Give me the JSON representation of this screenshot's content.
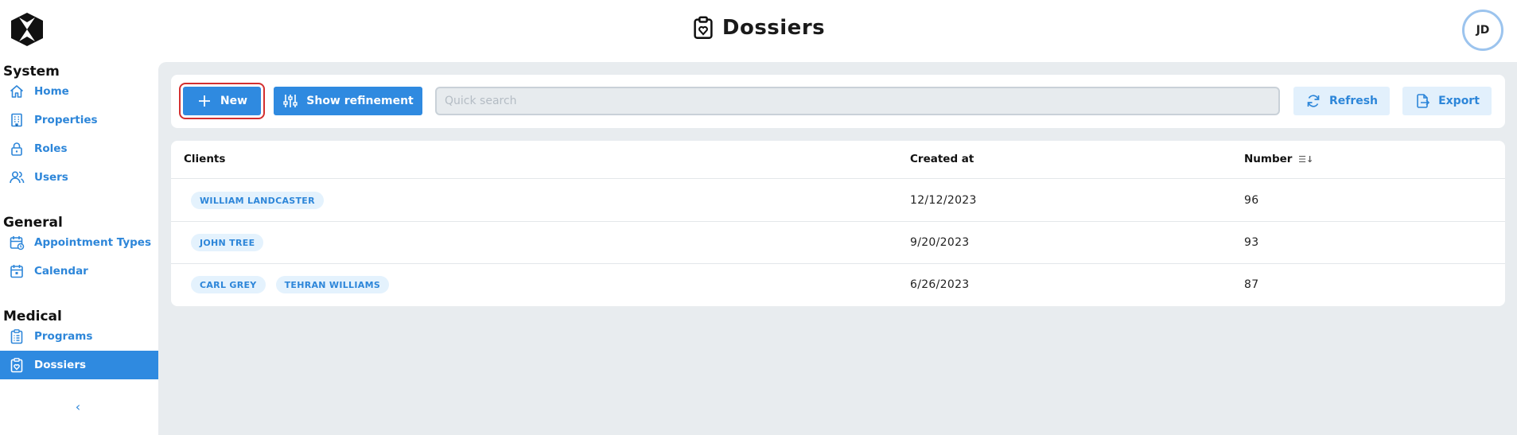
{
  "header": {
    "title": "Dossiers",
    "avatar_initials": "JD"
  },
  "sidebar": {
    "sections": [
      {
        "title": "System"
      },
      {
        "title": "General"
      },
      {
        "title": "Medical"
      }
    ],
    "items": [
      {
        "label": "Home",
        "icon": "home-icon"
      },
      {
        "label": "Properties",
        "icon": "building-icon"
      },
      {
        "label": "Roles",
        "icon": "lock-icon"
      },
      {
        "label": "Users",
        "icon": "users-icon"
      },
      {
        "label": "Appointment Types",
        "icon": "calendar-clock-icon"
      },
      {
        "label": "Calendar",
        "icon": "calendar-icon"
      },
      {
        "label": "Programs",
        "icon": "clipboard-list-icon"
      },
      {
        "label": "Dossiers",
        "icon": "clipboard-heart-icon",
        "active": true
      }
    ],
    "collapse_glyph": "‹"
  },
  "toolbar": {
    "new_label": "New",
    "refine_label": "Show refinement",
    "search_placeholder": "Quick search",
    "refresh_label": "Refresh",
    "export_label": "Export"
  },
  "table": {
    "columns": [
      "Clients",
      "Created at",
      "Number"
    ],
    "sort_glyph": "☰↓",
    "rows": [
      {
        "clients": [
          "WILLIAM LANDCASTER"
        ],
        "created_at": "12/12/2023",
        "number": "96"
      },
      {
        "clients": [
          "JOHN TREE"
        ],
        "created_at": "9/20/2023",
        "number": "93"
      },
      {
        "clients": [
          "CARL GREY",
          "TEHRAN WILLIAMS"
        ],
        "created_at": "6/26/2023",
        "number": "87"
      }
    ]
  },
  "colors": {
    "accent": "#2f8ae0",
    "content_bg": "#e8ecef",
    "chip_bg": "#e4f2fd",
    "highlight_outline": "#d32f2f"
  }
}
